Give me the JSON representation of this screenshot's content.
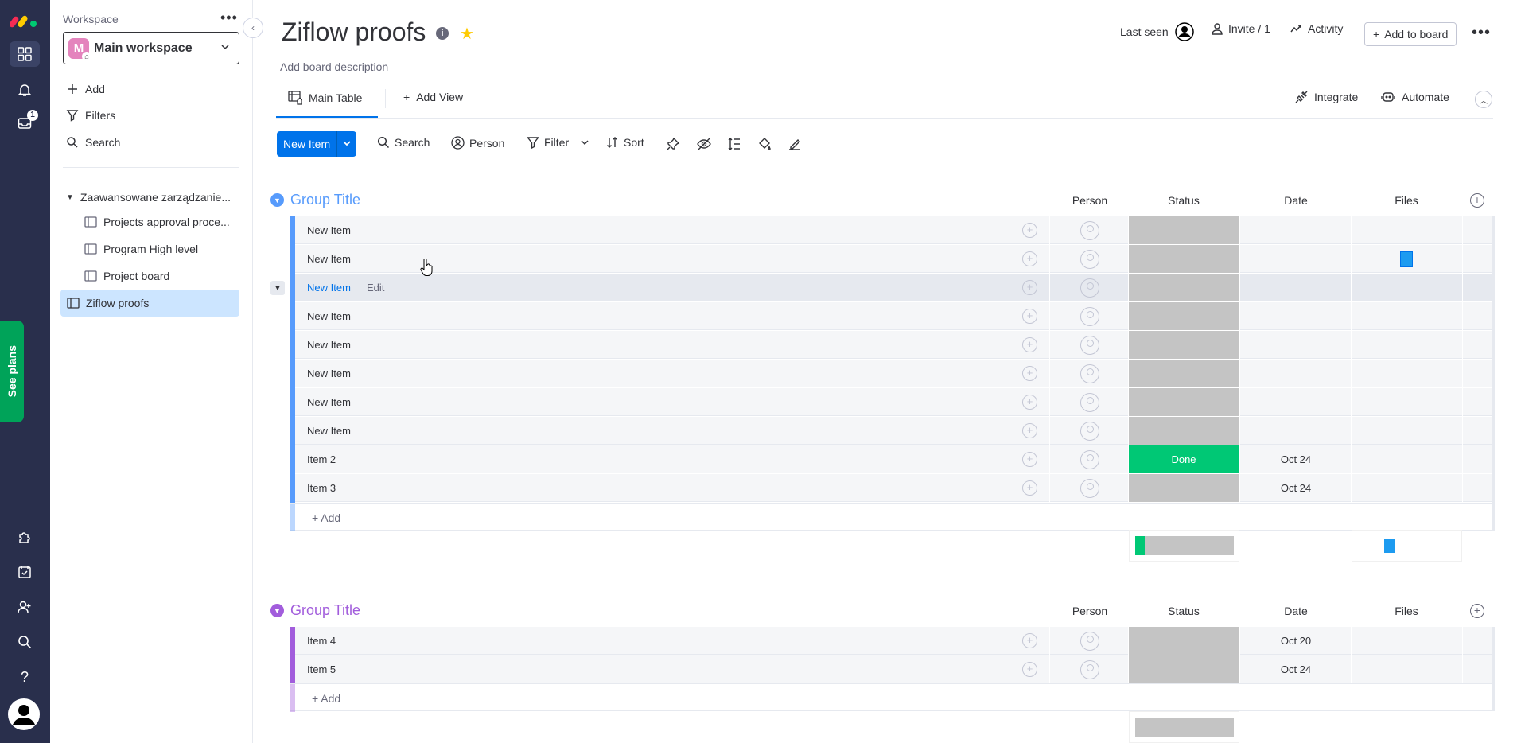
{
  "rail": {
    "inbox_badge": "1",
    "see_plans": "See plans"
  },
  "workspace": {
    "label": "Workspace",
    "selected": "Main workspace",
    "avatar_letter": "M",
    "actions": [
      "Add",
      "Filters",
      "Search"
    ],
    "folder": "Zaawansowane zarządzanie...",
    "boards": [
      "Projects approval proce...",
      "Program High level",
      "Project board",
      "Ziflow proofs"
    ]
  },
  "board": {
    "title": "Ziflow proofs",
    "description": "Add board description",
    "last_seen": "Last seen",
    "invite": "Invite / 1",
    "activity": "Activity",
    "add_to_board": "Add to board",
    "tabs": {
      "main": "Main Table",
      "add_view": "Add View"
    },
    "integrate": "Integrate",
    "automate": "Automate"
  },
  "toolbar": {
    "new_item": "New Item",
    "search": "Search",
    "person": "Person",
    "filter": "Filter",
    "sort": "Sort"
  },
  "columns": {
    "person": "Person",
    "status": "Status",
    "date": "Date",
    "files": "Files"
  },
  "groups": [
    {
      "title": "Group Title",
      "color": "#579bfc",
      "rows": [
        {
          "name": "New Item",
          "status": "",
          "date": "",
          "file": false
        },
        {
          "name": "New Item",
          "status": "",
          "date": "",
          "file": true
        },
        {
          "name": "New Item",
          "status": "",
          "date": "",
          "file": false,
          "hover": true,
          "edit": "Edit"
        },
        {
          "name": "New Item",
          "status": "",
          "date": "",
          "file": false
        },
        {
          "name": "New Item",
          "status": "",
          "date": "",
          "file": false
        },
        {
          "name": "New Item",
          "status": "",
          "date": "",
          "file": false
        },
        {
          "name": "New Item",
          "status": "",
          "date": "",
          "file": false
        },
        {
          "name": "New Item",
          "status": "",
          "date": "",
          "file": false
        },
        {
          "name": "Item 2",
          "status": "Done",
          "date": "Oct 24",
          "file": false
        },
        {
          "name": "Item 3",
          "status": "",
          "date": "Oct 24",
          "file": false
        }
      ],
      "add_label": "+ Add",
      "done_fraction": 0.1
    },
    {
      "title": "Group Title",
      "color": "#a25ddc",
      "rows": [
        {
          "name": "Item 4",
          "status": "",
          "date": "Oct 20",
          "file": false
        },
        {
          "name": "Item 5",
          "status": "",
          "date": "Oct 24",
          "file": false
        }
      ],
      "add_label": "+ Add",
      "done_fraction": 0
    }
  ],
  "colors": {
    "primary": "#0073ea",
    "done": "#00c875",
    "empty_status": "#c4c4c4",
    "rail": "#292f4c"
  }
}
